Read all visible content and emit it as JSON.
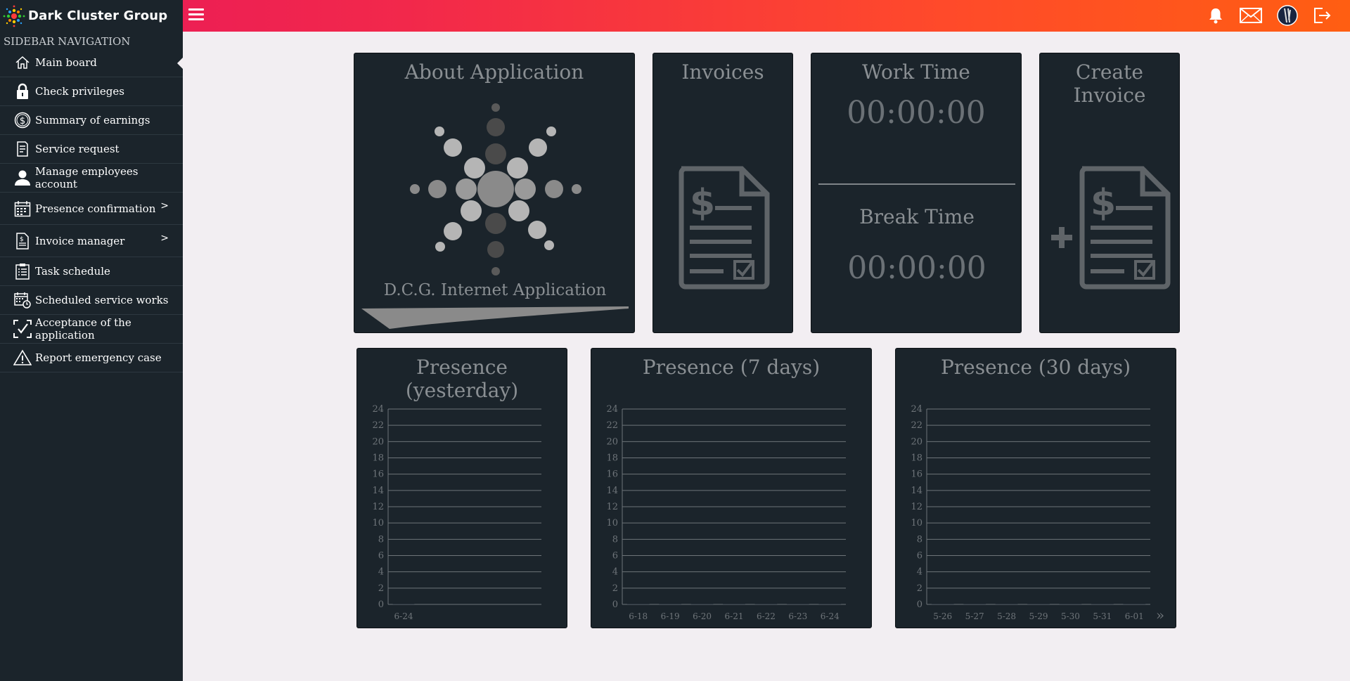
{
  "brand": {
    "name": "Dark Cluster Group"
  },
  "topbar": {
    "icons": [
      "bell-icon",
      "mail-icon",
      "avatar",
      "logout-icon"
    ]
  },
  "sidebar": {
    "heading": "SIDEBAR NAVIGATION",
    "items": [
      {
        "label": "Main board",
        "icon": "home-icon",
        "active": true
      },
      {
        "label": "Check privileges",
        "icon": "lock-icon"
      },
      {
        "label": "Summary of earnings",
        "icon": "dollar-icon"
      },
      {
        "label": "Service request",
        "icon": "document-icon"
      },
      {
        "label": "Manage employees account",
        "icon": "user-icon"
      },
      {
        "label": "Presence confirmation",
        "icon": "calendar-icon",
        "has_submenu": true
      },
      {
        "label": "Invoice manager",
        "icon": "invoice-icon",
        "has_submenu": true
      },
      {
        "label": "Task schedule",
        "icon": "clipboard-icon"
      },
      {
        "label": "Scheduled service works",
        "icon": "calendar-clock-icon"
      },
      {
        "label": "Acceptance of the application",
        "icon": "check-frame-icon"
      },
      {
        "label": "Report emergency case",
        "icon": "warning-icon"
      }
    ]
  },
  "cards": {
    "about": {
      "title": "About Application",
      "subtitle": "D.C.G. Internet Application"
    },
    "invoices": {
      "title": "Invoices"
    },
    "work_time": {
      "title": "Work Time",
      "value": "00:00:00",
      "break_title": "Break Time",
      "break_value": "00:00:00"
    },
    "create_invoice": {
      "title": "Create Invoice"
    }
  },
  "chart_data": [
    {
      "type": "bar",
      "title": "Presence (yesterday)",
      "categories": [
        "6-24"
      ],
      "values": [
        0
      ],
      "ylim": [
        0,
        24
      ],
      "yticks": [
        0,
        2,
        4,
        6,
        8,
        10,
        12,
        14,
        16,
        18,
        20,
        22,
        24
      ],
      "grid": true
    },
    {
      "type": "bar",
      "title": "Presence (7 days)",
      "categories": [
        "6-18",
        "6-19",
        "6-20",
        "6-21",
        "6-22",
        "6-23",
        "6-24"
      ],
      "values": [
        0,
        0,
        0,
        0,
        0,
        0,
        0
      ],
      "ylim": [
        0,
        24
      ],
      "yticks": [
        0,
        2,
        4,
        6,
        8,
        10,
        12,
        14,
        16,
        18,
        20,
        22,
        24
      ],
      "grid": true
    },
    {
      "type": "bar",
      "title": "Presence (30 days)",
      "categories": [
        "5-26",
        "5-27",
        "5-28",
        "5-29",
        "5-30",
        "5-31",
        "6-01"
      ],
      "values": [
        0,
        0,
        0,
        0,
        0,
        0,
        0
      ],
      "ylim": [
        0,
        24
      ],
      "yticks": [
        0,
        2,
        4,
        6,
        8,
        10,
        12,
        14,
        16,
        18,
        20,
        22,
        24
      ],
      "grid": true,
      "more_indicator": "»"
    }
  ]
}
